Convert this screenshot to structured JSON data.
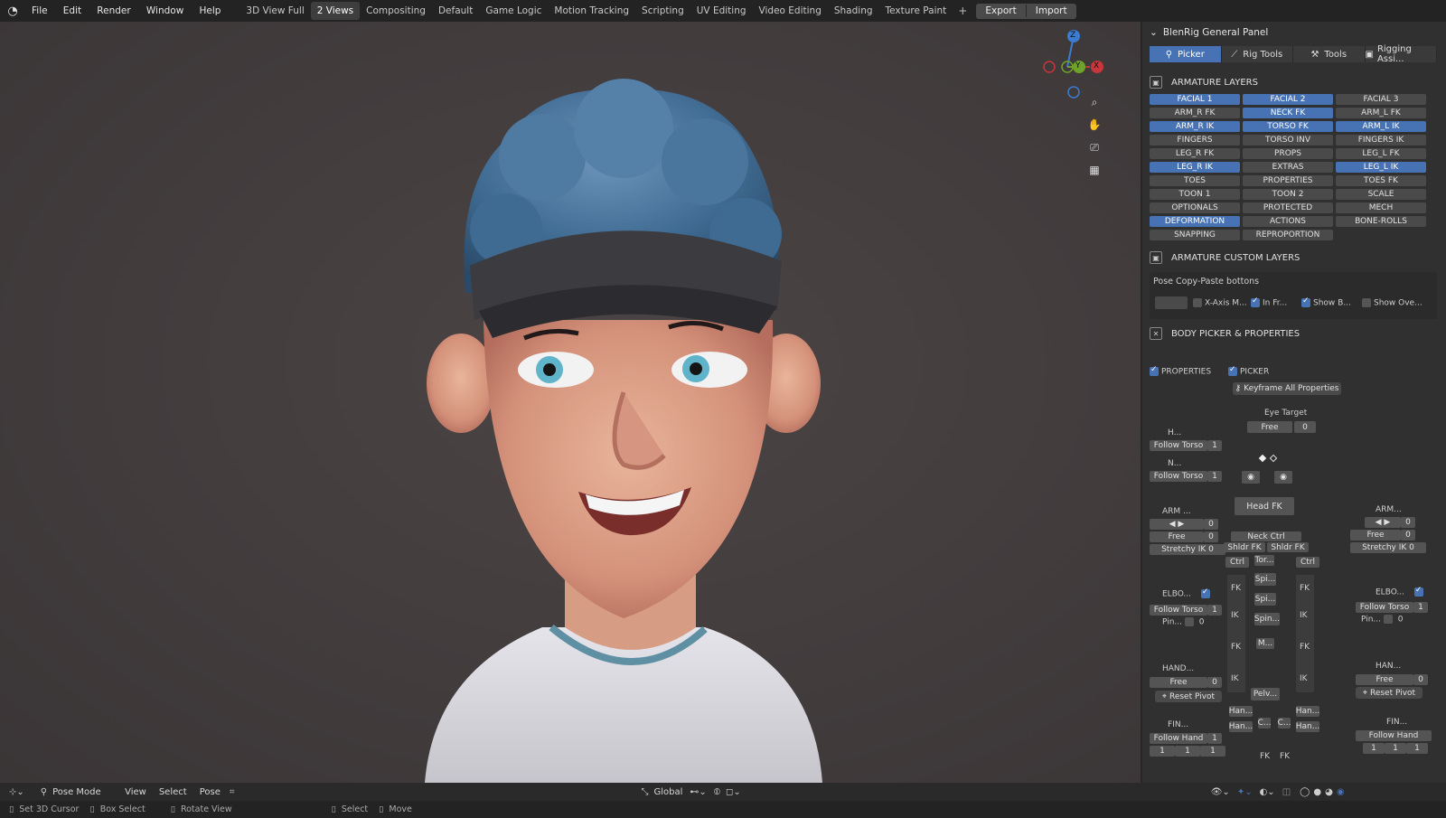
{
  "menu": [
    "File",
    "Edit",
    "Render",
    "Window",
    "Help"
  ],
  "workspaces": [
    "3D View Full",
    "2 Views",
    "Compositing",
    "Default",
    "Game Logic",
    "Motion Tracking",
    "Scripting",
    "UV Editing",
    "Video Editing",
    "Shading",
    "Texture Paint"
  ],
  "active_workspace": "2 Views",
  "export_label": "Export",
  "import_label": "Import",
  "gizmo": {
    "z": "Z",
    "y": "Y",
    "x": "X"
  },
  "panel": {
    "title": "BlenRig General Panel",
    "tabs": [
      "Picker",
      "Rig Tools",
      "Tools",
      "Rigging Assi..."
    ],
    "armature_layers_title": "ARMATURE LAYERS",
    "layers": [
      {
        "label": "FACIAL 1",
        "on": true
      },
      {
        "label": "FACIAL 2",
        "on": true
      },
      {
        "label": "FACIAL 3",
        "on": false
      },
      {
        "label": "ARM_R FK",
        "on": false
      },
      {
        "label": "NECK FK",
        "on": true
      },
      {
        "label": "ARM_L FK",
        "on": false
      },
      {
        "label": "ARM_R IK",
        "on": true
      },
      {
        "label": "TORSO FK",
        "on": true
      },
      {
        "label": "ARM_L IK",
        "on": true
      },
      {
        "label": "FINGERS",
        "on": false
      },
      {
        "label": "TORSO INV",
        "on": false
      },
      {
        "label": "FINGERS IK",
        "on": false
      },
      {
        "label": "LEG_R FK",
        "on": false
      },
      {
        "label": "PROPS",
        "on": false
      },
      {
        "label": "LEG_L FK",
        "on": false
      },
      {
        "label": "LEG_R IK",
        "on": true
      },
      {
        "label": "EXTRAS",
        "on": false
      },
      {
        "label": "LEG_L IK",
        "on": true
      },
      {
        "label": "TOES",
        "on": false
      },
      {
        "label": "PROPERTIES",
        "on": false
      },
      {
        "label": "TOES FK",
        "on": false
      },
      {
        "label": "TOON 1",
        "on": false
      },
      {
        "label": "TOON 2",
        "on": false
      },
      {
        "label": "SCALE",
        "on": false
      },
      {
        "label": "OPTIONALS",
        "on": false
      },
      {
        "label": "PROTECTED",
        "on": false
      },
      {
        "label": "MECH",
        "on": false
      },
      {
        "label": "DEFORMATION",
        "on": true
      },
      {
        "label": "ACTIONS",
        "on": false
      },
      {
        "label": "BONE-ROLLS",
        "on": false
      },
      {
        "label": "SNAPPING",
        "on": false
      },
      {
        "label": "REPROPORTION",
        "on": false
      }
    ],
    "custom_layers_title": "ARMATURE CUSTOM LAYERS",
    "copy_paste_title": "Pose Copy-Paste bottons",
    "copy_opts": [
      "X-Axis M...",
      "In Fr...",
      "Show B...",
      "Show Ove..."
    ],
    "body_picker_title": "BODY PICKER & PROPERTIES",
    "properties_label": "PROPERTIES",
    "picker_label": "PICKER",
    "keyframe_all": "Keyframe All Properties",
    "eye_target": "Eye Target",
    "free": "Free",
    "zero": "0",
    "one": "1",
    "h_label": "H...",
    "n_label": "N...",
    "follow_torso": "Follow Torso",
    "arm_label": "ARM ...",
    "arm_label_r": "ARM...",
    "stretchy_ik": "Stretchy IK 0",
    "elbo": "ELBO...",
    "pin": "Pin...",
    "hand": "HAND...",
    "han": "HAN...",
    "reset_pivot": "Reset Pivot",
    "fin": "FIN...",
    "follow_hand": "Follow Hand",
    "head_fk": "Head FK",
    "neck_ctrl": "Neck Ctrl",
    "shldr_fk": "Shldr FK",
    "ctrl": "Ctrl",
    "fk": "FK",
    "ik": "IK",
    "tor": "Tor...",
    "spi": "Spi...",
    "spin": "Spin...",
    "m": "M...",
    "pelv": "Pelv...",
    "han_short": "Han...",
    "c_short": "C..."
  },
  "toolbar": {
    "mode": "Pose Mode",
    "items": [
      "View",
      "Select",
      "Pose"
    ],
    "orientation": "Global"
  },
  "status": [
    "Set 3D Cursor",
    "Box Select",
    "Rotate View",
    "Select",
    "Move"
  ]
}
